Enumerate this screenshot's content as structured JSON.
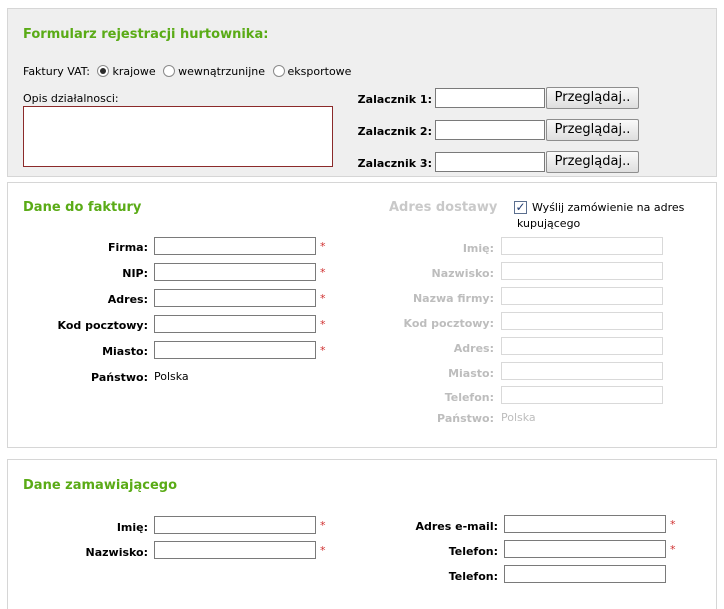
{
  "registration": {
    "title": "Formularz rejestracji hurtownika:",
    "vat_label": "Faktury VAT:",
    "vat_options": [
      "krajowe",
      "wewnątrzunijne",
      "eksportowe"
    ],
    "vat_selected": "krajowe",
    "description_label": "Opis działalnosci:",
    "attachments": [
      {
        "label": "Zalacznik 1:",
        "button": "Przeglądaj.."
      },
      {
        "label": "Zalacznik 2:",
        "button": "Przeglądaj.."
      },
      {
        "label": "Zalacznik 3:",
        "button": "Przeglądaj.."
      }
    ]
  },
  "invoice": {
    "title": "Dane do faktury",
    "fields": [
      {
        "label": "Firma:",
        "required": "*"
      },
      {
        "label": "NIP:",
        "required": "*"
      },
      {
        "label": "Adres:",
        "required": "*"
      },
      {
        "label": "Kod pocztowy:",
        "required": "*"
      },
      {
        "label": "Miasto:",
        "required": "*"
      }
    ],
    "country_label": "Państwo:",
    "country_value": "Polska"
  },
  "delivery": {
    "title": "Adres dostawy",
    "checkbox_checked": true,
    "checkbox_label_line1": "Wyślij zamówienie na adres",
    "checkbox_label_line2": "kupującego",
    "fields": [
      "Imię:",
      "Nazwisko:",
      "Nazwa firmy:",
      "Kod pocztowy:",
      "Adres:",
      "Miasto:",
      "Telefon:"
    ],
    "country_label": "Państwo:",
    "country_value": "Polska"
  },
  "orderer": {
    "title": "Dane zamawiającego",
    "left_fields": [
      {
        "label": "Imię:",
        "required": "*"
      },
      {
        "label": "Nazwisko:",
        "required": "*"
      }
    ],
    "right_fields": [
      {
        "label": "Adres e-mail:",
        "required": "*"
      },
      {
        "label": "Telefon:",
        "required": "*"
      },
      {
        "label": "Telefon:",
        "required": ""
      }
    ]
  },
  "colors": {
    "accent_green": "#5aab16",
    "required_red": "#d03030",
    "disabled_gray": "#bdbdbd"
  }
}
